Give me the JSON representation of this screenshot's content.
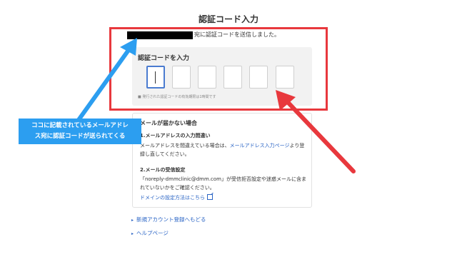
{
  "page": {
    "title": "認証コード入力",
    "sent_message": "宛に認証コードを送信しました。"
  },
  "code_entry": {
    "heading": "認証コードを入力",
    "digit_count": 6,
    "expiry_note": "■ 発行された認証コードの有効期限は1時間です"
  },
  "help": {
    "title": "メールが届かない場合",
    "section1": {
      "title": "1.メールアドレスの入力間違い",
      "body_prefix": "メールアドレスを間違えている場合は、",
      "link": "メールアドレス入力ページ",
      "body_suffix": "より登録し直してください。"
    },
    "section2": {
      "title": "2.メールの受信設定",
      "body": "「noreply-dmmclinic@dmm.com」が受信拒否設定や迷惑メールに含まれていないかをご確認ください。",
      "link": "ドメインの設定方法はこちら"
    }
  },
  "links": {
    "new_account": "新規アカウント登録へもどる",
    "help_page": "ヘルプページ"
  },
  "annotation": {
    "callout_line1": "ココに記載されているメールアドレ",
    "callout_line2": "ス宛に認証コードが送られてくる",
    "callout_color": "#2c9ef0",
    "highlight_color": "#e8383d"
  }
}
